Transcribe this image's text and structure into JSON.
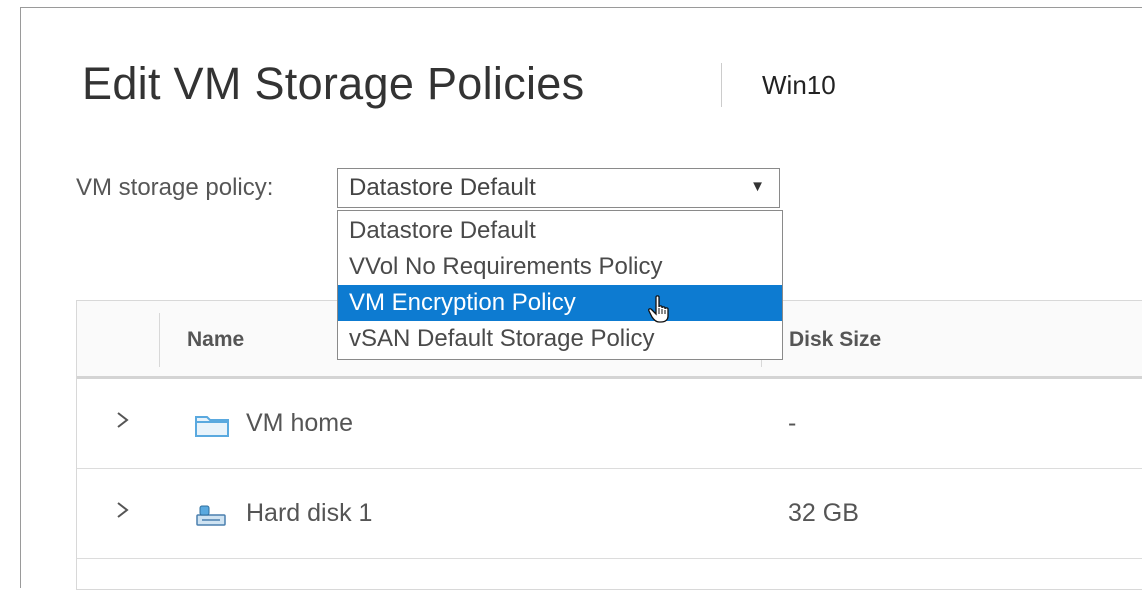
{
  "dialog": {
    "title": "Edit VM Storage Policies",
    "vm_name": "Win10"
  },
  "policy_field": {
    "label": "VM storage policy:",
    "selected_value": "Datastore Default",
    "dropdown_icon": "chevron-down-icon",
    "options": [
      "Datastore Default",
      "VVol No Requirements Policy",
      "VM Encryption Policy",
      "vSAN Default Storage Policy"
    ],
    "highlighted_option": "VM Encryption Policy"
  },
  "grid": {
    "columns": [
      "Name",
      "Disk Size"
    ],
    "rows": [
      {
        "name": "VM home",
        "disk_size": "-",
        "icon": "folder-icon"
      },
      {
        "name": "Hard disk 1",
        "disk_size": "32 GB",
        "icon": "hard-disk-icon"
      }
    ]
  },
  "colors": {
    "highlight": "#0d7bd1",
    "folder_icon": "#5aa9df"
  }
}
